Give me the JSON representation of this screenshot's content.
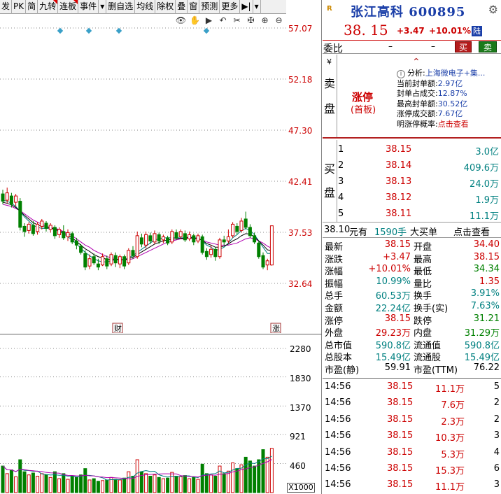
{
  "toolbar": {
    "items": [
      "发",
      "PK",
      "简",
      "九转",
      "连板",
      "事件",
      "▾",
      "删自选",
      "均线",
      "除权",
      "叠",
      "窗",
      "预测",
      "更多",
      "▶|",
      "▾"
    ]
  },
  "tool_icons": [
    "👁",
    "✋",
    "▶",
    "↶",
    "✂",
    "✠",
    "⊕",
    "⊖"
  ],
  "price_axis": [
    "57.07",
    "52.18",
    "47.30",
    "42.41",
    "37.53",
    "32.64"
  ],
  "volume_axis": [
    "2280",
    "1830",
    "1370",
    "921",
    "460"
  ],
  "volume_unit": "X1000",
  "event_markers": {
    "cai": "财",
    "zhang": "涨"
  },
  "header": {
    "logo": "R",
    "title": "张江高科 600895",
    "price": "38. 15",
    "change": "+3.47",
    "change_pct": "+10.01%",
    "badge": "陆"
  },
  "weibi": {
    "label": "委比",
    "v1": "–",
    "v2": "–",
    "buy": "买",
    "sell": "卖"
  },
  "sell_block": {
    "yen": "¥",
    "side": [
      "卖",
      "盘"
    ],
    "limit_up": "涨停",
    "limit_sub": "(首板)",
    "analysis": [
      {
        "label": "分析:",
        "value": "上海微电子+集..."
      },
      {
        "label": "当前封单额:",
        "value": "2.97亿"
      },
      {
        "label": "封单占成交:",
        "value": "12.87%"
      },
      {
        "label": "最高封单额:",
        "value": "30.52亿"
      },
      {
        "label": "涨停成交额:",
        "value": "7.67亿"
      },
      {
        "label": "明涨停概率:",
        "value": "点击查看"
      }
    ]
  },
  "buy_block": {
    "side": [
      "买",
      "盘"
    ],
    "rows": [
      {
        "level": "1",
        "price": "38.15",
        "vol": "3.0亿"
      },
      {
        "level": "2",
        "price": "38.14",
        "vol": "409.6万"
      },
      {
        "level": "3",
        "price": "38.13",
        "vol": "24.0万"
      },
      {
        "level": "4",
        "price": "38.12",
        "vol": "1.9万"
      },
      {
        "level": "5",
        "price": "38.11",
        "vol": "11.1万"
      }
    ]
  },
  "summary": {
    "price": "38.10",
    "unit1": "元有",
    "qty": "1590手",
    "big": "大买单",
    "link": "点击查看"
  },
  "stats": [
    {
      "l": "最新",
      "lv": "38.15",
      "lc": "red",
      "r": "开盘",
      "rv": "34.40",
      "rc": "red"
    },
    {
      "l": "涨跌",
      "lv": "+3.47",
      "lc": "red",
      "r": "最高",
      "rv": "38.15",
      "rc": "red"
    },
    {
      "l": "涨幅",
      "lv": "+10.01%",
      "lc": "red",
      "r": "最低",
      "rv": "34.34",
      "rc": "green"
    },
    {
      "l": "振幅",
      "lv": "10.99%",
      "lc": "teal",
      "r": "量比",
      "rv": "1.35",
      "rc": "red"
    },
    {
      "l": "总手",
      "lv": "60.53万",
      "lc": "teal",
      "r": "换手",
      "rv": "3.91%",
      "rc": "teal"
    },
    {
      "l": "金额",
      "lv": "22.24亿",
      "lc": "teal",
      "r": "换手(实)",
      "rv": "7.63%",
      "rc": "teal"
    },
    {
      "l": "涨停",
      "lv": "38.15",
      "lc": "red",
      "r": "跌停",
      "rv": "31.21",
      "rc": "green"
    },
    {
      "l": "外盘",
      "lv": "29.23万",
      "lc": "red",
      "r": "内盘",
      "rv": "31.29万",
      "rc": "green"
    },
    {
      "l": "总市值",
      "lv": "590.8亿",
      "lc": "teal",
      "r": "流通值",
      "rv": "590.8亿",
      "rc": "teal"
    },
    {
      "l": "总股本",
      "lv": "15.49亿",
      "lc": "teal",
      "r": "流通股",
      "rv": "15.49亿",
      "rc": "teal"
    },
    {
      "l": "市盈(静)",
      "lv": "59.91",
      "lc": "blk",
      "r": "市盈(TTM)",
      "rv": "76.22",
      "rc": "blk"
    }
  ],
  "ticks": [
    {
      "t": "14:56",
      "p": "38.15",
      "v": "11.1万",
      "n": "5"
    },
    {
      "t": "14:56",
      "p": "38.15",
      "v": "7.6万",
      "n": "2"
    },
    {
      "t": "14:56",
      "p": "38.15",
      "v": "2.3万",
      "n": "2"
    },
    {
      "t": "14:56",
      "p": "38.15",
      "v": "10.3万",
      "n": "3"
    },
    {
      "t": "14:56",
      "p": "38.15",
      "v": "5.3万",
      "n": "4"
    },
    {
      "t": "14:56",
      "p": "38.15",
      "v": "15.3万",
      "n": "6"
    },
    {
      "t": "14:56",
      "p": "38.15",
      "v": "11.1万",
      "n": "3"
    }
  ],
  "colors": {
    "up": "#cc0000",
    "down": "#008000",
    "teal": "#008080",
    "blue": "#1a3ea8",
    "ma5": "#000000",
    "ma10": "#b000b0",
    "ma20": "#008080"
  },
  "chart_data": {
    "type": "candlestick",
    "y_range": [
      32.64,
      57.07
    ],
    "candles": [
      {
        "o": 41.2,
        "c": 40.5,
        "h": 41.6,
        "l": 40.2
      },
      {
        "o": 40.6,
        "c": 41.3,
        "h": 41.8,
        "l": 40.3
      },
      {
        "o": 41.0,
        "c": 40.2,
        "h": 41.3,
        "l": 39.9
      },
      {
        "o": 40.4,
        "c": 41.0,
        "h": 41.2,
        "l": 40.0
      },
      {
        "o": 40.5,
        "c": 38.0,
        "h": 40.8,
        "l": 37.7
      },
      {
        "o": 38.1,
        "c": 37.6,
        "h": 38.4,
        "l": 37.1
      },
      {
        "o": 37.7,
        "c": 38.3,
        "h": 38.5,
        "l": 37.4
      },
      {
        "o": 38.2,
        "c": 37.4,
        "h": 38.6,
        "l": 37.2
      },
      {
        "o": 37.6,
        "c": 38.3,
        "h": 38.5,
        "l": 37.3
      },
      {
        "o": 38.1,
        "c": 38.6,
        "h": 38.8,
        "l": 37.8
      },
      {
        "o": 38.4,
        "c": 37.9,
        "h": 38.6,
        "l": 37.6
      },
      {
        "o": 37.8,
        "c": 38.2,
        "h": 38.4,
        "l": 37.5
      },
      {
        "o": 38.0,
        "c": 37.2,
        "h": 38.2,
        "l": 36.9
      },
      {
        "o": 37.3,
        "c": 37.8,
        "h": 38.0,
        "l": 37.0
      },
      {
        "o": 37.6,
        "c": 37.0,
        "h": 38.2,
        "l": 36.8
      },
      {
        "o": 37.1,
        "c": 37.5,
        "h": 37.8,
        "l": 36.7
      },
      {
        "o": 37.4,
        "c": 36.6,
        "h": 37.6,
        "l": 36.4
      },
      {
        "o": 36.7,
        "c": 36.3,
        "h": 37.0,
        "l": 35.9
      },
      {
        "o": 36.2,
        "c": 35.6,
        "h": 36.4,
        "l": 35.4
      },
      {
        "o": 35.5,
        "c": 34.2,
        "h": 35.8,
        "l": 33.9
      },
      {
        "o": 34.3,
        "c": 35.0,
        "h": 35.4,
        "l": 34.0
      },
      {
        "o": 35.2,
        "c": 34.6,
        "h": 35.5,
        "l": 34.4
      },
      {
        "o": 34.5,
        "c": 34.2,
        "h": 35.0,
        "l": 33.9
      },
      {
        "o": 34.4,
        "c": 35.2,
        "h": 35.5,
        "l": 34.3
      },
      {
        "o": 35.0,
        "c": 34.3,
        "h": 35.3,
        "l": 34.0
      },
      {
        "o": 34.5,
        "c": 35.4,
        "h": 35.6,
        "l": 34.3
      },
      {
        "o": 35.3,
        "c": 34.6,
        "h": 35.6,
        "l": 34.2
      },
      {
        "o": 34.5,
        "c": 35.2,
        "h": 35.4,
        "l": 34.1
      },
      {
        "o": 35.2,
        "c": 34.3,
        "h": 35.4,
        "l": 34.0
      },
      {
        "o": 34.6,
        "c": 35.8,
        "h": 36.0,
        "l": 34.4
      },
      {
        "o": 35.8,
        "c": 35.3,
        "h": 36.2,
        "l": 35.0
      },
      {
        "o": 35.2,
        "c": 37.2,
        "h": 37.6,
        "l": 35.0
      },
      {
        "o": 37.0,
        "c": 36.4,
        "h": 37.4,
        "l": 36.1
      },
      {
        "o": 36.3,
        "c": 37.3,
        "h": 37.6,
        "l": 36.0
      },
      {
        "o": 37.2,
        "c": 36.7,
        "h": 37.5,
        "l": 36.4
      },
      {
        "o": 36.6,
        "c": 37.4,
        "h": 37.7,
        "l": 36.4
      },
      {
        "o": 37.3,
        "c": 36.7,
        "h": 37.5,
        "l": 36.4
      },
      {
        "o": 36.8,
        "c": 37.1,
        "h": 37.3,
        "l": 36.5
      },
      {
        "o": 37.0,
        "c": 36.5,
        "h": 37.2,
        "l": 36.3
      },
      {
        "o": 36.6,
        "c": 37.6,
        "h": 37.8,
        "l": 36.4
      },
      {
        "o": 37.5,
        "c": 37.0,
        "h": 37.8,
        "l": 36.8
      },
      {
        "o": 37.1,
        "c": 37.6,
        "h": 37.8,
        "l": 36.9
      },
      {
        "o": 37.4,
        "c": 36.8,
        "h": 37.7,
        "l": 36.6
      },
      {
        "o": 36.9,
        "c": 37.3,
        "h": 37.6,
        "l": 36.7
      },
      {
        "o": 37.2,
        "c": 36.6,
        "h": 37.4,
        "l": 36.3
      },
      {
        "o": 36.7,
        "c": 37.2,
        "h": 37.4,
        "l": 36.5
      },
      {
        "o": 37.1,
        "c": 35.6,
        "h": 37.3,
        "l": 35.4
      },
      {
        "o": 35.7,
        "c": 35.2,
        "h": 36.0,
        "l": 34.9
      },
      {
        "o": 35.4,
        "c": 35.9,
        "h": 36.3,
        "l": 35.1
      },
      {
        "o": 35.9,
        "c": 35.2,
        "h": 36.1,
        "l": 34.8
      },
      {
        "o": 35.2,
        "c": 36.8,
        "h": 37.0,
        "l": 35.0
      },
      {
        "o": 36.8,
        "c": 36.6,
        "h": 37.2,
        "l": 36.3
      },
      {
        "o": 36.7,
        "c": 37.1,
        "h": 37.8,
        "l": 36.5
      },
      {
        "o": 37.2,
        "c": 38.3,
        "h": 38.5,
        "l": 37.0
      },
      {
        "o": 38.1,
        "c": 37.6,
        "h": 38.4,
        "l": 37.3
      },
      {
        "o": 37.7,
        "c": 38.6,
        "h": 38.9,
        "l": 37.5
      },
      {
        "o": 38.8,
        "c": 38.0,
        "h": 39.5,
        "l": 37.8
      },
      {
        "o": 38.0,
        "c": 37.2,
        "h": 38.3,
        "l": 37.0
      },
      {
        "o": 37.2,
        "c": 36.6,
        "h": 37.5,
        "l": 36.4
      },
      {
        "o": 36.5,
        "c": 35.2,
        "h": 36.7,
        "l": 35.0
      },
      {
        "o": 35.3,
        "c": 34.2,
        "h": 35.6,
        "l": 34.0
      },
      {
        "o": 34.4,
        "c": 34.8,
        "h": 35.0,
        "l": 33.9
      },
      {
        "o": 34.4,
        "c": 38.15,
        "h": 38.15,
        "l": 34.34
      }
    ],
    "ma5": [
      40.6,
      40.5,
      40.3,
      40.0,
      39.5,
      39.0,
      38.6,
      38.2,
      38.0,
      37.9,
      37.9,
      37.9,
      37.8,
      37.6,
      37.4,
      37.1,
      36.8,
      36.4,
      36.0,
      35.6,
      35.3,
      35.0,
      34.8,
      34.7,
      34.7,
      34.8,
      34.9,
      34.9,
      34.9,
      35.1,
      35.3,
      35.6,
      35.9,
      36.2,
      36.5,
      36.8,
      36.9,
      37.0,
      37.0,
      37.0,
      37.0,
      37.0,
      37.0,
      37.1,
      37.0,
      37.0,
      36.7,
      36.3,
      36.1,
      35.8,
      35.9,
      36.1,
      36.5,
      37.0,
      37.3,
      37.7,
      37.9,
      37.7,
      37.3,
      36.7,
      36.1,
      35.5,
      35.5
    ],
    "ma10": [
      40.2,
      40.1,
      40.0,
      39.8,
      39.6,
      39.3,
      39.0,
      38.7,
      38.5,
      38.3,
      38.1,
      38.0,
      37.9,
      37.8,
      37.6,
      37.4,
      37.2,
      36.9,
      36.6,
      36.3,
      36.1,
      35.8,
      35.6,
      35.4,
      35.2,
      35.1,
      35.0,
      34.9,
      34.9,
      34.9,
      35.0,
      35.2,
      35.4,
      35.6,
      35.8,
      36.0,
      36.2,
      36.4,
      36.6,
      36.7,
      36.8,
      36.9,
      36.9,
      37.0,
      36.9,
      36.9,
      36.8,
      36.6,
      36.5,
      36.4,
      36.3,
      36.3,
      36.3,
      36.4,
      36.5,
      36.7,
      36.9,
      37.0,
      36.9,
      36.7,
      36.5,
      36.2,
      36.0
    ],
    "volume": [
      {
        "v": 420,
        "up": false
      },
      {
        "v": 300,
        "up": true
      },
      {
        "v": 360,
        "up": false
      },
      {
        "v": 250,
        "up": true
      },
      {
        "v": 520,
        "up": false
      },
      {
        "v": 330,
        "up": false
      },
      {
        "v": 280,
        "up": true
      },
      {
        "v": 310,
        "up": false
      },
      {
        "v": 260,
        "up": true
      },
      {
        "v": 300,
        "up": true
      },
      {
        "v": 280,
        "up": false
      },
      {
        "v": 240,
        "up": true
      },
      {
        "v": 330,
        "up": false
      },
      {
        "v": 220,
        "up": true
      },
      {
        "v": 300,
        "up": false
      },
      {
        "v": 210,
        "up": true
      },
      {
        "v": 260,
        "up": false
      },
      {
        "v": 240,
        "up": false
      },
      {
        "v": 280,
        "up": false
      },
      {
        "v": 380,
        "up": false
      },
      {
        "v": 200,
        "up": true
      },
      {
        "v": 220,
        "up": false
      },
      {
        "v": 180,
        "up": false
      },
      {
        "v": 190,
        "up": true
      },
      {
        "v": 200,
        "up": false
      },
      {
        "v": 240,
        "up": true
      },
      {
        "v": 210,
        "up": false
      },
      {
        "v": 200,
        "up": true
      },
      {
        "v": 230,
        "up": false
      },
      {
        "v": 330,
        "up": true
      },
      {
        "v": 260,
        "up": false
      },
      {
        "v": 520,
        "up": true
      },
      {
        "v": 330,
        "up": false
      },
      {
        "v": 300,
        "up": true
      },
      {
        "v": 260,
        "up": false
      },
      {
        "v": 280,
        "up": true
      },
      {
        "v": 240,
        "up": false
      },
      {
        "v": 220,
        "up": true
      },
      {
        "v": 230,
        "up": false
      },
      {
        "v": 320,
        "up": true
      },
      {
        "v": 260,
        "up": false
      },
      {
        "v": 250,
        "up": true
      },
      {
        "v": 270,
        "up": false
      },
      {
        "v": 220,
        "up": true
      },
      {
        "v": 240,
        "up": false
      },
      {
        "v": 210,
        "up": true
      },
      {
        "v": 450,
        "up": false
      },
      {
        "v": 300,
        "up": false
      },
      {
        "v": 280,
        "up": true
      },
      {
        "v": 260,
        "up": false
      },
      {
        "v": 420,
        "up": true
      },
      {
        "v": 300,
        "up": false
      },
      {
        "v": 340,
        "up": true
      },
      {
        "v": 470,
        "up": true
      },
      {
        "v": 380,
        "up": false
      },
      {
        "v": 440,
        "up": true
      },
      {
        "v": 560,
        "up": false
      },
      {
        "v": 500,
        "up": false
      },
      {
        "v": 420,
        "up": false
      },
      {
        "v": 520,
        "up": false
      },
      {
        "v": 680,
        "up": false
      },
      {
        "v": 560,
        "up": true
      },
      {
        "v": 700,
        "up": true
      }
    ],
    "volume_range": [
      0,
      2280
    ]
  }
}
